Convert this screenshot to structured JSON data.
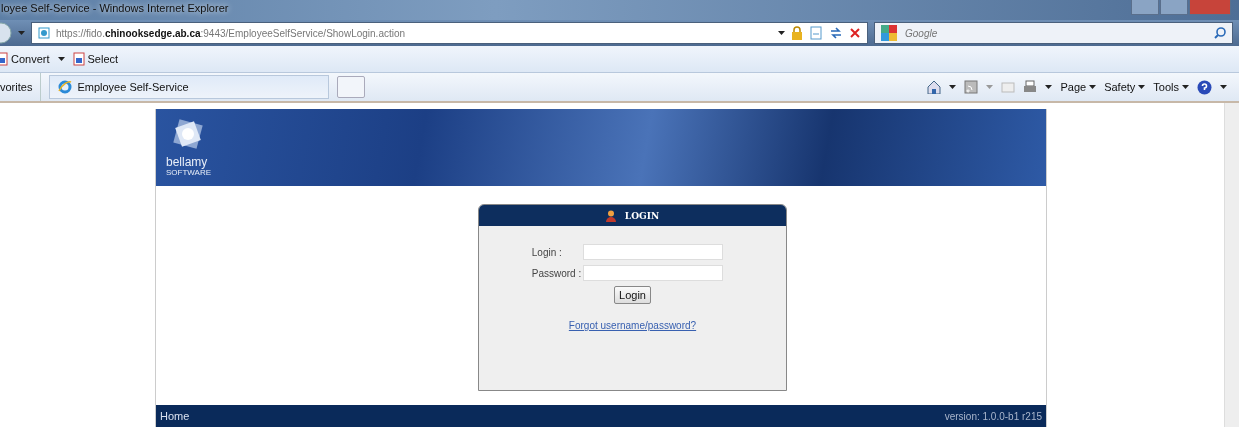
{
  "window": {
    "title": "loyee Self-Service - Windows Internet Explorer"
  },
  "address_bar": {
    "url": "https://fido.**chinooksedge.ab.ca**:9443/EmployeeSelfService/ShowLogin.action"
  },
  "search": {
    "placeholder": "Google"
  },
  "command_bar": {
    "items": [
      "Convert",
      "Select"
    ]
  },
  "favorites_bar": {
    "label": "vorites",
    "tabs": [
      {
        "label": "Employee Self-Service",
        "selected": true
      }
    ],
    "menus": [
      "Page",
      "Safety",
      "Tools"
    ]
  },
  "page": {
    "logo": {
      "name": "bellamy",
      "sub": "SOFTWARE"
    },
    "login_panel": {
      "title": "LOGIN",
      "fields": [
        {
          "label": "Login :"
        },
        {
          "label": "Password :"
        }
      ],
      "button": "Login",
      "link": "Forgot username/password?"
    },
    "footer": {
      "home": "Home",
      "version": "version: 1.0.0-b1 r215"
    }
  }
}
